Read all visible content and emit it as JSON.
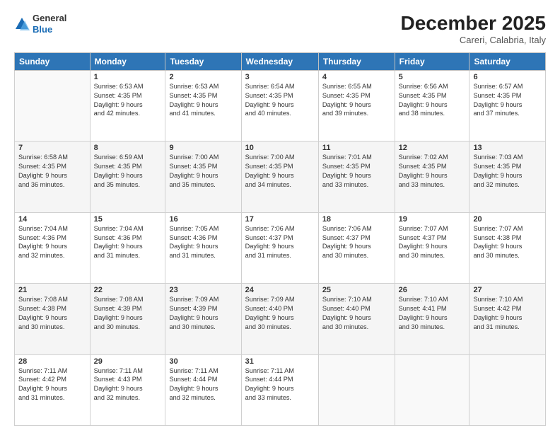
{
  "header": {
    "logo_general": "General",
    "logo_blue": "Blue",
    "month_title": "December 2025",
    "location": "Careri, Calabria, Italy"
  },
  "days_of_week": [
    "Sunday",
    "Monday",
    "Tuesday",
    "Wednesday",
    "Thursday",
    "Friday",
    "Saturday"
  ],
  "weeks": [
    [
      {
        "day": "",
        "content": ""
      },
      {
        "day": "1",
        "content": "Sunrise: 6:53 AM\nSunset: 4:35 PM\nDaylight: 9 hours\nand 42 minutes."
      },
      {
        "day": "2",
        "content": "Sunrise: 6:53 AM\nSunset: 4:35 PM\nDaylight: 9 hours\nand 41 minutes."
      },
      {
        "day": "3",
        "content": "Sunrise: 6:54 AM\nSunset: 4:35 PM\nDaylight: 9 hours\nand 40 minutes."
      },
      {
        "day": "4",
        "content": "Sunrise: 6:55 AM\nSunset: 4:35 PM\nDaylight: 9 hours\nand 39 minutes."
      },
      {
        "day": "5",
        "content": "Sunrise: 6:56 AM\nSunset: 4:35 PM\nDaylight: 9 hours\nand 38 minutes."
      },
      {
        "day": "6",
        "content": "Sunrise: 6:57 AM\nSunset: 4:35 PM\nDaylight: 9 hours\nand 37 minutes."
      }
    ],
    [
      {
        "day": "7",
        "content": "Sunrise: 6:58 AM\nSunset: 4:35 PM\nDaylight: 9 hours\nand 36 minutes."
      },
      {
        "day": "8",
        "content": "Sunrise: 6:59 AM\nSunset: 4:35 PM\nDaylight: 9 hours\nand 35 minutes."
      },
      {
        "day": "9",
        "content": "Sunrise: 7:00 AM\nSunset: 4:35 PM\nDaylight: 9 hours\nand 35 minutes."
      },
      {
        "day": "10",
        "content": "Sunrise: 7:00 AM\nSunset: 4:35 PM\nDaylight: 9 hours\nand 34 minutes."
      },
      {
        "day": "11",
        "content": "Sunrise: 7:01 AM\nSunset: 4:35 PM\nDaylight: 9 hours\nand 33 minutes."
      },
      {
        "day": "12",
        "content": "Sunrise: 7:02 AM\nSunset: 4:35 PM\nDaylight: 9 hours\nand 33 minutes."
      },
      {
        "day": "13",
        "content": "Sunrise: 7:03 AM\nSunset: 4:35 PM\nDaylight: 9 hours\nand 32 minutes."
      }
    ],
    [
      {
        "day": "14",
        "content": "Sunrise: 7:04 AM\nSunset: 4:36 PM\nDaylight: 9 hours\nand 32 minutes."
      },
      {
        "day": "15",
        "content": "Sunrise: 7:04 AM\nSunset: 4:36 PM\nDaylight: 9 hours\nand 31 minutes."
      },
      {
        "day": "16",
        "content": "Sunrise: 7:05 AM\nSunset: 4:36 PM\nDaylight: 9 hours\nand 31 minutes."
      },
      {
        "day": "17",
        "content": "Sunrise: 7:06 AM\nSunset: 4:37 PM\nDaylight: 9 hours\nand 31 minutes."
      },
      {
        "day": "18",
        "content": "Sunrise: 7:06 AM\nSunset: 4:37 PM\nDaylight: 9 hours\nand 30 minutes."
      },
      {
        "day": "19",
        "content": "Sunrise: 7:07 AM\nSunset: 4:37 PM\nDaylight: 9 hours\nand 30 minutes."
      },
      {
        "day": "20",
        "content": "Sunrise: 7:07 AM\nSunset: 4:38 PM\nDaylight: 9 hours\nand 30 minutes."
      }
    ],
    [
      {
        "day": "21",
        "content": "Sunrise: 7:08 AM\nSunset: 4:38 PM\nDaylight: 9 hours\nand 30 minutes."
      },
      {
        "day": "22",
        "content": "Sunrise: 7:08 AM\nSunset: 4:39 PM\nDaylight: 9 hours\nand 30 minutes."
      },
      {
        "day": "23",
        "content": "Sunrise: 7:09 AM\nSunset: 4:39 PM\nDaylight: 9 hours\nand 30 minutes."
      },
      {
        "day": "24",
        "content": "Sunrise: 7:09 AM\nSunset: 4:40 PM\nDaylight: 9 hours\nand 30 minutes."
      },
      {
        "day": "25",
        "content": "Sunrise: 7:10 AM\nSunset: 4:40 PM\nDaylight: 9 hours\nand 30 minutes."
      },
      {
        "day": "26",
        "content": "Sunrise: 7:10 AM\nSunset: 4:41 PM\nDaylight: 9 hours\nand 30 minutes."
      },
      {
        "day": "27",
        "content": "Sunrise: 7:10 AM\nSunset: 4:42 PM\nDaylight: 9 hours\nand 31 minutes."
      }
    ],
    [
      {
        "day": "28",
        "content": "Sunrise: 7:11 AM\nSunset: 4:42 PM\nDaylight: 9 hours\nand 31 minutes."
      },
      {
        "day": "29",
        "content": "Sunrise: 7:11 AM\nSunset: 4:43 PM\nDaylight: 9 hours\nand 32 minutes."
      },
      {
        "day": "30",
        "content": "Sunrise: 7:11 AM\nSunset: 4:44 PM\nDaylight: 9 hours\nand 32 minutes."
      },
      {
        "day": "31",
        "content": "Sunrise: 7:11 AM\nSunset: 4:44 PM\nDaylight: 9 hours\nand 33 minutes."
      },
      {
        "day": "",
        "content": ""
      },
      {
        "day": "",
        "content": ""
      },
      {
        "day": "",
        "content": ""
      }
    ]
  ]
}
